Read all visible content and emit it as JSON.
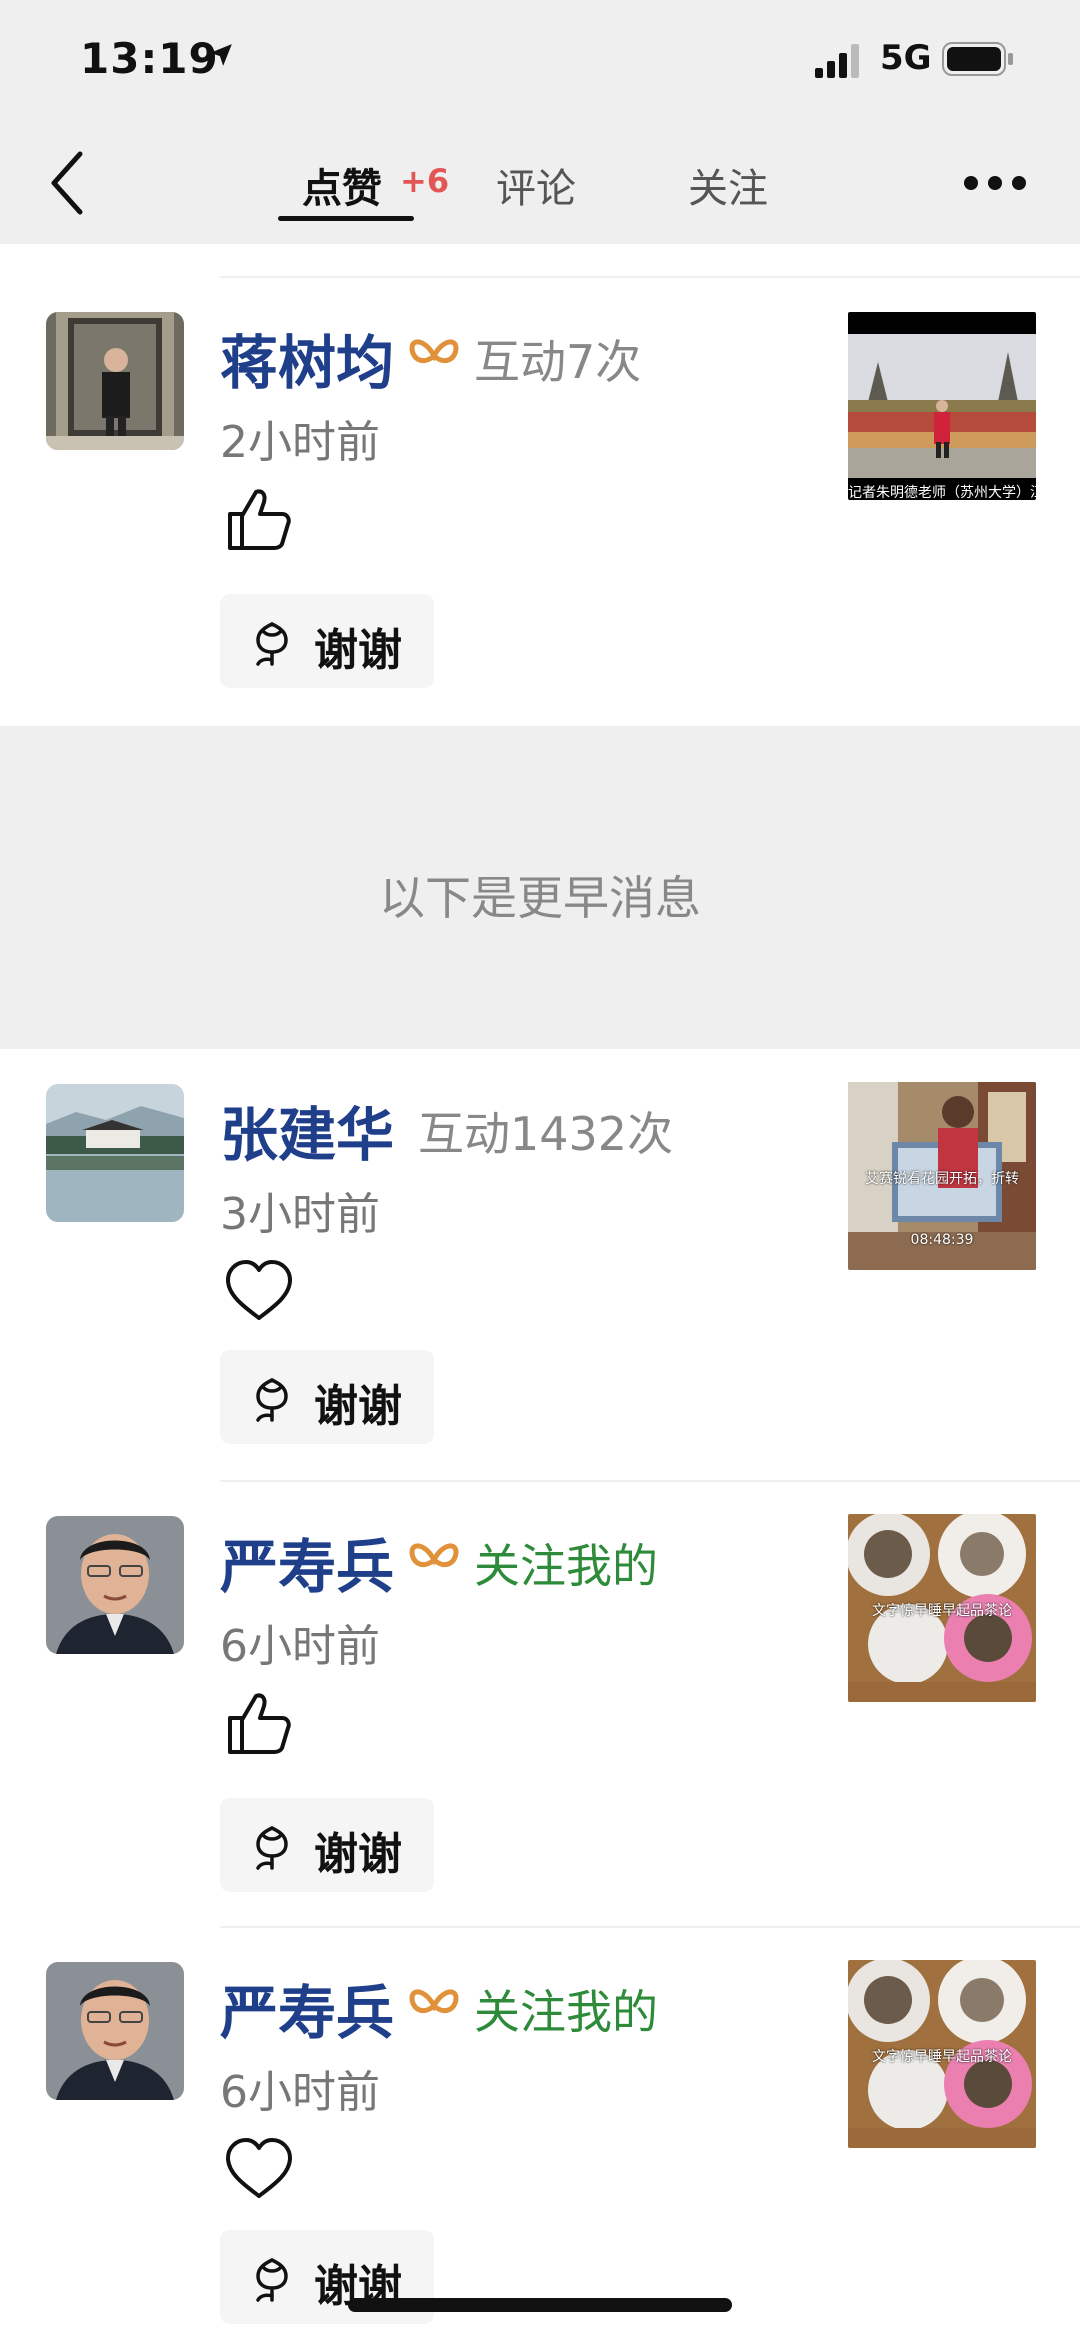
{
  "status_bar": {
    "time": "13:19",
    "network": "5G"
  },
  "nav": {
    "tabs": [
      {
        "label": "点赞",
        "badge": "+6",
        "active": true
      },
      {
        "label": "评论"
      },
      {
        "label": "关注"
      }
    ]
  },
  "notifications": [
    {
      "name": "蒋树均",
      "vip": true,
      "meta": "互动7次",
      "meta_color": "gray",
      "time": "2小时前",
      "reaction": "thumbs-up",
      "thanks_label": "谢谢",
      "thumb_caption": "记者朱明德老师（苏州大学）江"
    },
    {
      "name": "张建华",
      "vip": false,
      "meta": "互动1432次",
      "meta_color": "gray",
      "time": "3小时前",
      "reaction": "heart",
      "thanks_label": "谢谢",
      "thumb_caption": "艾赛锐看花园开拓，折转",
      "thumb_time": "08:48:39"
    },
    {
      "name": "严寿兵",
      "vip": true,
      "meta": "关注我的",
      "meta_color": "green",
      "time": "6小时前",
      "reaction": "thumbs-up",
      "thanks_label": "谢谢",
      "thumb_caption": "文字惊早睡早起品茶论"
    },
    {
      "name": "严寿兵",
      "vip": true,
      "meta": "关注我的",
      "meta_color": "green",
      "time": "6小时前",
      "reaction": "heart",
      "thanks_label": "谢谢",
      "thumb_caption": "文字惊早睡早起品茶论"
    }
  ],
  "earlier_label": "以下是更早消息",
  "colors": {
    "name": "#1f3f8a",
    "badge": "#e45555",
    "green": "#2e8b3a",
    "gray_bg": "#efefef",
    "vip": "#e0913a"
  }
}
